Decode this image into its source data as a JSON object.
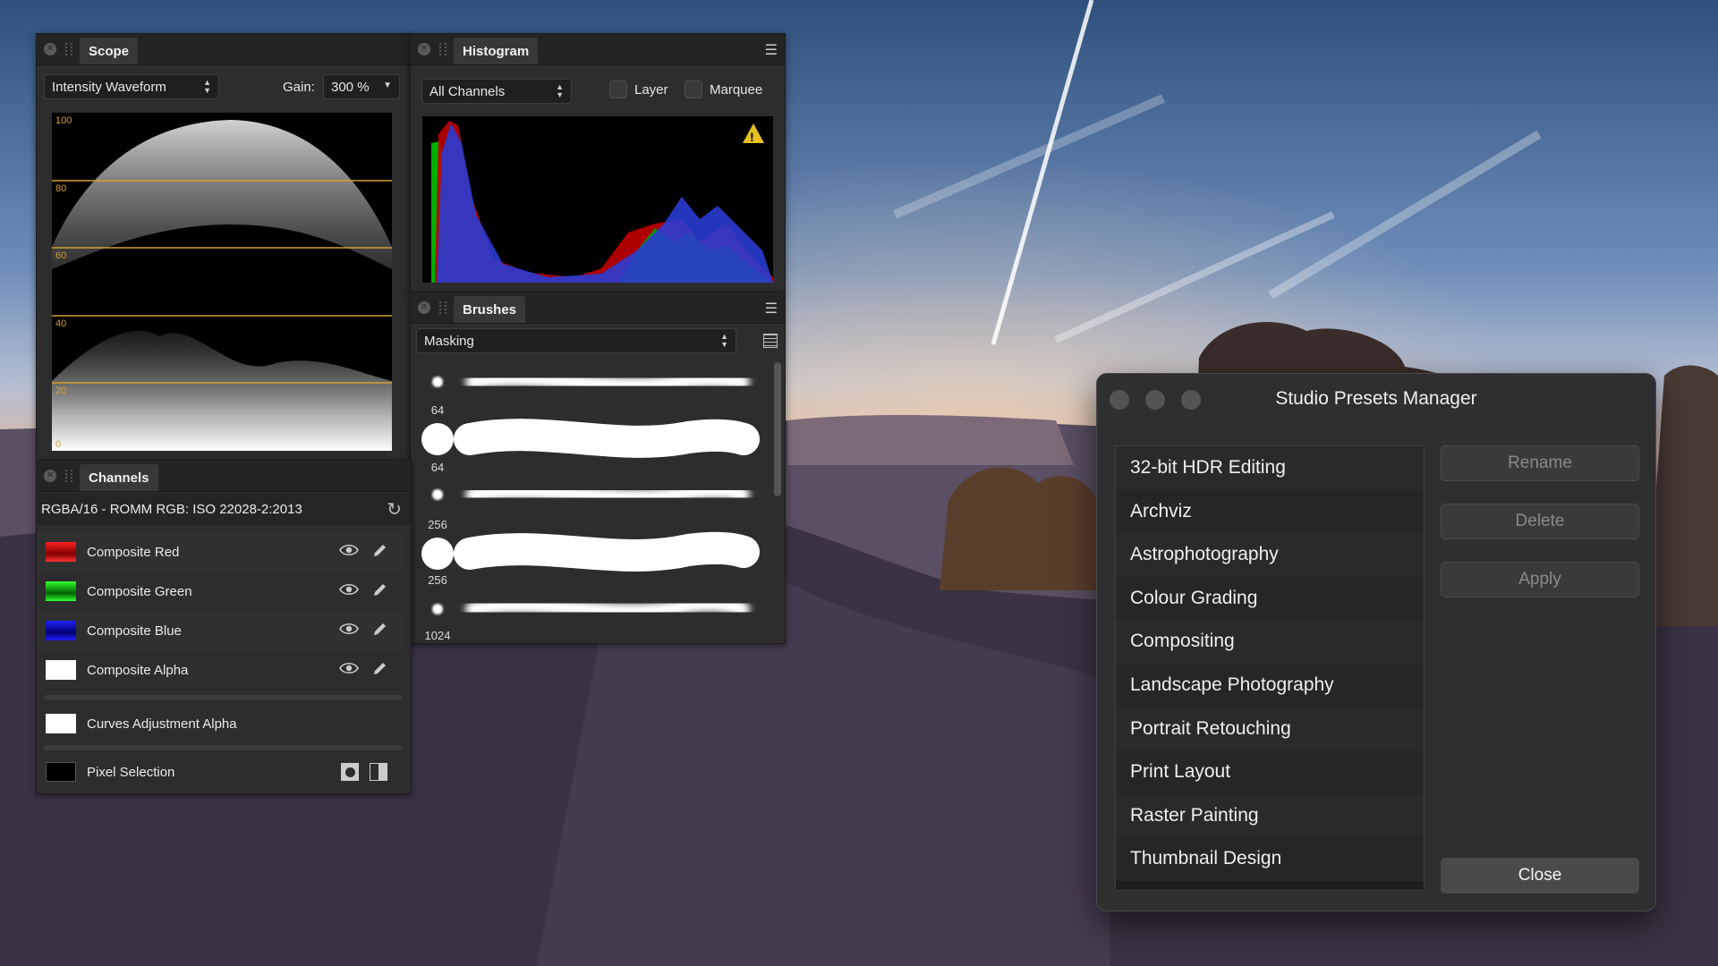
{
  "scope": {
    "tab_label": "Scope",
    "mode": "Intensity Waveform",
    "gain_label": "Gain:",
    "gain_value": "300 %",
    "scale_labels": [
      "100",
      "80",
      "60",
      "40",
      "20",
      "0"
    ]
  },
  "histogram": {
    "tab_label": "Histogram",
    "channel_select": "All Channels",
    "layer_label": "Layer",
    "marquee_label": "Marquee"
  },
  "brushes": {
    "tab_label": "Brushes",
    "category": "Masking",
    "sizes": [
      "64",
      "64",
      "256",
      "256",
      "1024"
    ]
  },
  "channels": {
    "tab_label": "Channels",
    "color_profile": "RGBA/16 - ROMM RGB: ISO 22028-2:2013",
    "items": [
      {
        "label": "Composite Red",
        "color": "#e00000"
      },
      {
        "label": "Composite Green",
        "color": "#00c000"
      },
      {
        "label": "Composite Blue",
        "color": "#0000e0"
      },
      {
        "label": "Composite Alpha",
        "color": "#ffffff"
      }
    ],
    "curves_alpha": "Curves Adjustment Alpha",
    "pixel_selection": "Pixel Selection"
  },
  "presets_manager": {
    "title": "Studio Presets Manager",
    "presets": [
      "32-bit HDR Editing",
      "Archviz",
      "Astrophotography",
      "Colour Grading",
      "Compositing",
      "Landscape Photography",
      "Portrait Retouching",
      "Print Layout",
      "Raster Painting",
      "Thumbnail Design"
    ],
    "rename_label": "Rename",
    "delete_label": "Delete",
    "apply_label": "Apply",
    "close_label": "Close"
  }
}
